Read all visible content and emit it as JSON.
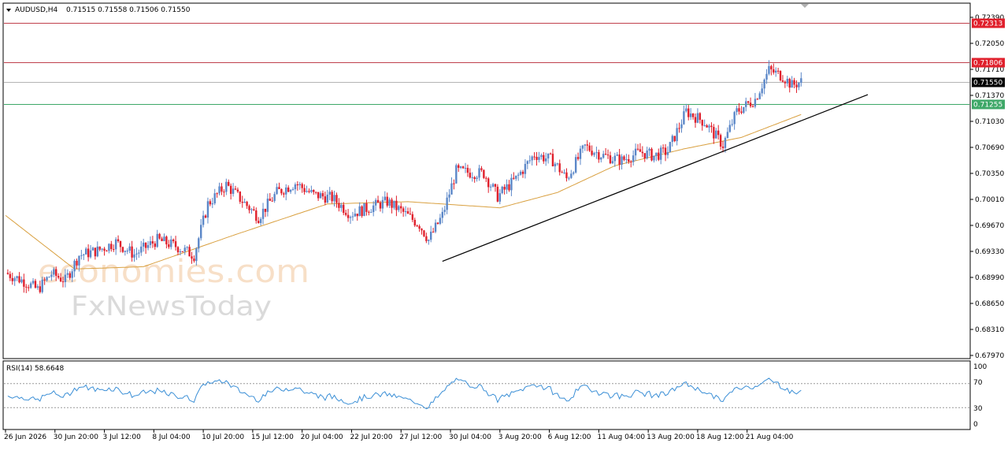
{
  "header": {
    "symbol_timeframe": "AUDUSD,H4",
    "ohlc": "0.71515 0.71558 0.71506 0.71550"
  },
  "rsi_panel": {
    "label": "RSI(14) 58.6648",
    "levels": [
      "100",
      "70",
      "30",
      "0"
    ]
  },
  "watermark": {
    "line1": "economies.com",
    "line2": "FxNewsToday"
  },
  "colors": {
    "bull_candle": "#5b87c8",
    "bear_candle": "#e0202c",
    "moving_average": "#d9a040",
    "resistance_line": "#c0404c",
    "support_line": "#3ea868",
    "current_price_line": "#b4b4b4",
    "trendline": "#000000",
    "rsi_line": "#3b8fd6"
  },
  "chart_data": {
    "type": "candlestick",
    "symbol": "AUDUSD",
    "timeframe": "H4",
    "y_axis_ticks": [
      "0.72390",
      "0.72050",
      "0.71710",
      "0.71370",
      "0.71030",
      "0.70690",
      "0.70350",
      "0.70010",
      "0.69670",
      "0.69330",
      "0.68990",
      "0.68650",
      "0.68310",
      "0.67970"
    ],
    "ylim": [
      0.6797,
      0.7239
    ],
    "x_axis_ticks": [
      "26 Jun 2026",
      "30 Jun 20:00",
      "3 Jul 12:00",
      "8 Jul 04:00",
      "10 Jul 20:00",
      "15 Jul 12:00",
      "20 Jul 04:00",
      "22 Jul 20:00",
      "27 Jul 12:00",
      "30 Jul 04:00",
      "3 Aug 20:00",
      "6 Aug 12:00",
      "11 Aug 04:00",
      "13 Aug 20:00",
      "18 Aug 12:00",
      "21 Aug 04:00"
    ],
    "price_lines": [
      {
        "label": "0.72313",
        "value": 0.72313,
        "kind": "resistance"
      },
      {
        "label": "0.71806",
        "value": 0.71806,
        "kind": "resistance"
      },
      {
        "label": "0.71550",
        "value": 0.7155,
        "kind": "current"
      },
      {
        "label": "0.71255",
        "value": 0.71255,
        "kind": "support"
      }
    ],
    "path_waypoints": [
      {
        "t": 0,
        "v": 0.6905
      },
      {
        "t": 8,
        "v": 0.6894
      },
      {
        "t": 14,
        "v": 0.6883
      },
      {
        "t": 20,
        "v": 0.6904
      },
      {
        "t": 26,
        "v": 0.6895
      },
      {
        "t": 32,
        "v": 0.6928
      },
      {
        "t": 40,
        "v": 0.6934
      },
      {
        "t": 48,
        "v": 0.6945
      },
      {
        "t": 56,
        "v": 0.6929
      },
      {
        "t": 66,
        "v": 0.6948
      },
      {
        "t": 74,
        "v": 0.694
      },
      {
        "t": 82,
        "v": 0.6928
      },
      {
        "t": 88,
        "v": 0.6995
      },
      {
        "t": 96,
        "v": 0.702
      },
      {
        "t": 104,
        "v": 0.6996
      },
      {
        "t": 110,
        "v": 0.6978
      },
      {
        "t": 118,
        "v": 0.701
      },
      {
        "t": 126,
        "v": 0.7022
      },
      {
        "t": 134,
        "v": 0.7007
      },
      {
        "t": 142,
        "v": 0.7003
      },
      {
        "t": 150,
        "v": 0.6982
      },
      {
        "t": 158,
        "v": 0.699
      },
      {
        "t": 166,
        "v": 0.6998
      },
      {
        "t": 172,
        "v": 0.6986
      },
      {
        "t": 180,
        "v": 0.6968
      },
      {
        "t": 184,
        "v": 0.6948
      },
      {
        "t": 190,
        "v": 0.698
      },
      {
        "t": 196,
        "v": 0.7038
      },
      {
        "t": 202,
        "v": 0.7036
      },
      {
        "t": 208,
        "v": 0.7035
      },
      {
        "t": 214,
        "v": 0.7005
      },
      {
        "t": 222,
        "v": 0.7028
      },
      {
        "t": 230,
        "v": 0.706
      },
      {
        "t": 238,
        "v": 0.7052
      },
      {
        "t": 244,
        "v": 0.7028
      },
      {
        "t": 252,
        "v": 0.707
      },
      {
        "t": 260,
        "v": 0.7058
      },
      {
        "t": 268,
        "v": 0.7052
      },
      {
        "t": 276,
        "v": 0.7063
      },
      {
        "t": 282,
        "v": 0.7058
      },
      {
        "t": 288,
        "v": 0.7064
      },
      {
        "t": 296,
        "v": 0.7116
      },
      {
        "t": 304,
        "v": 0.7102
      },
      {
        "t": 312,
        "v": 0.7072
      },
      {
        "t": 318,
        "v": 0.7116
      },
      {
        "t": 326,
        "v": 0.7132
      },
      {
        "t": 332,
        "v": 0.717
      },
      {
        "t": 338,
        "v": 0.7162
      },
      {
        "t": 342,
        "v": 0.715
      },
      {
        "t": 346,
        "v": 0.7155
      }
    ],
    "moving_average_waypoints": [
      {
        "t": 0,
        "v": 0.698
      },
      {
        "t": 30,
        "v": 0.691
      },
      {
        "t": 60,
        "v": 0.6913
      },
      {
        "t": 100,
        "v": 0.6955
      },
      {
        "t": 140,
        "v": 0.6995
      },
      {
        "t": 175,
        "v": 0.6998
      },
      {
        "t": 215,
        "v": 0.699
      },
      {
        "t": 240,
        "v": 0.701
      },
      {
        "t": 265,
        "v": 0.7045
      },
      {
        "t": 295,
        "v": 0.7067
      },
      {
        "t": 320,
        "v": 0.7082
      },
      {
        "t": 346,
        "v": 0.7112
      }
    ],
    "trendline": [
      {
        "t": 190,
        "v": 0.692
      },
      {
        "t": 375,
        "v": 0.7138
      }
    ],
    "rsi": {
      "value": 58.6648,
      "levels": [
        70,
        30
      ],
      "range": [
        0,
        100
      ]
    }
  }
}
